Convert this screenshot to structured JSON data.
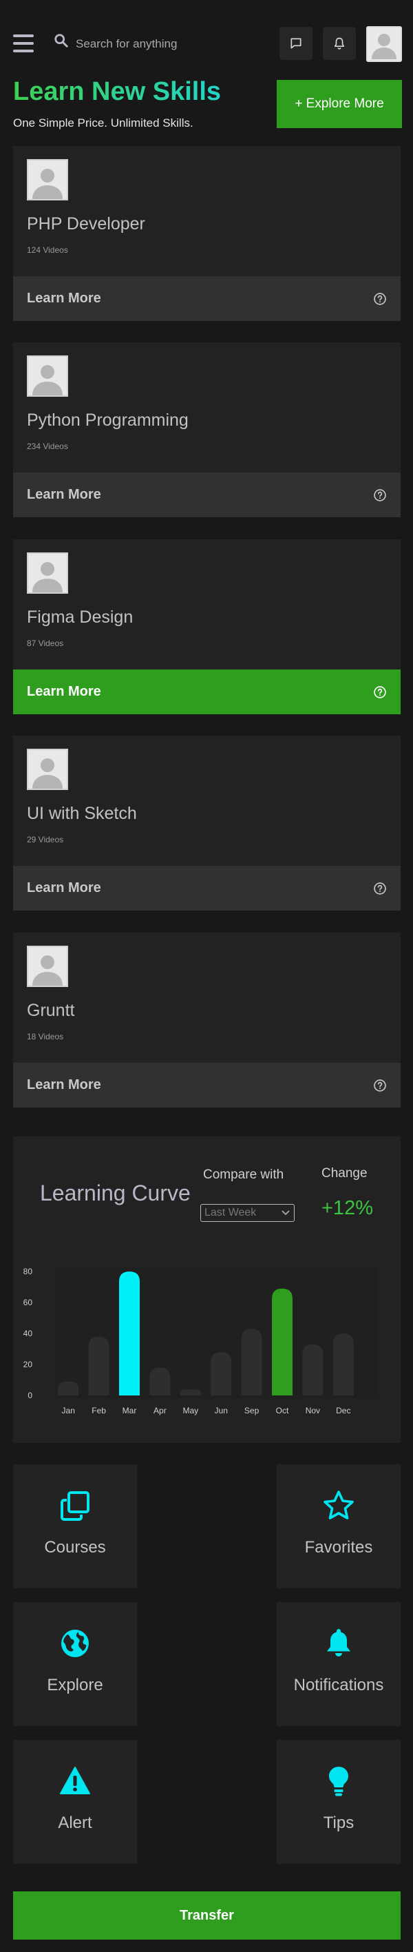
{
  "header": {
    "search_placeholder": "Search for anything"
  },
  "hero": {
    "title": "Learn New Skills",
    "subtitle": "One Simple Price. Unlimited Skills.",
    "explore_label": "+ Explore More"
  },
  "courses": [
    {
      "title": "PHP Developer",
      "count": "124 Videos",
      "cta": "Learn More",
      "active": false
    },
    {
      "title": "Python Programming",
      "count": "234 Videos",
      "cta": "Learn More",
      "active": false
    },
    {
      "title": "Figma Design",
      "count": "87 Videos",
      "cta": "Learn More",
      "active": true
    },
    {
      "title": "UI with Sketch",
      "count": "29 Videos",
      "cta": "Learn More",
      "active": false
    },
    {
      "title": "Gruntt",
      "count": "18 Videos",
      "cta": "Learn More",
      "active": false
    }
  ],
  "curve": {
    "title": "Learning Curve",
    "compare_label": "Compare with",
    "compare_value": "Last Week",
    "change_label": "Change",
    "change_value": "+12%"
  },
  "chart_data": {
    "type": "bar",
    "categories": [
      "Jan",
      "Feb",
      "Mar",
      "Apr",
      "May",
      "Jun",
      "Sep",
      "Oct",
      "Nov",
      "Dec"
    ],
    "values": [
      9,
      38,
      80,
      18,
      4,
      28,
      43,
      69,
      33,
      40
    ],
    "ylim": [
      0,
      80
    ],
    "yticks": [
      0,
      20,
      40,
      60,
      80
    ],
    "highlight": {
      "Mar": "#00f0f8",
      "Oct": "#2f9e1f"
    },
    "bar_color": "#2e2e2e",
    "grid": false
  },
  "tiles": [
    {
      "label": "Courses",
      "icon": "copy-icon"
    },
    {
      "label": "Favorites",
      "icon": "star-icon"
    },
    {
      "label": "Explore",
      "icon": "globe-icon"
    },
    {
      "label": "Notifications",
      "icon": "bell-icon"
    },
    {
      "label": "Alert",
      "icon": "warning-icon"
    },
    {
      "label": "Tips",
      "icon": "lightbulb-icon"
    }
  ],
  "colors": {
    "accent_cyan": "#00e5f0",
    "accent_green": "#2f9e1f"
  },
  "transfer_label": "Transfer"
}
